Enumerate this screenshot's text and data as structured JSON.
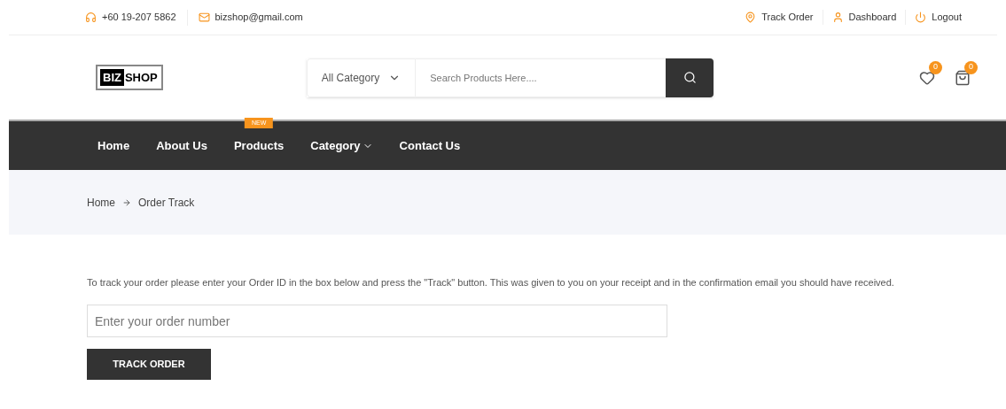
{
  "topbar": {
    "phone": "+60 19-207 5862",
    "email": "bizshop@gmail.com",
    "links": [
      {
        "kind": "pin",
        "label": "Track Order"
      },
      {
        "kind": "user",
        "label": "Dashboard"
      },
      {
        "kind": "power",
        "label": "Logout"
      }
    ]
  },
  "header": {
    "logo": {
      "dark_part": "BIZ",
      "light_part": "SHOP"
    },
    "category_select": "All Category",
    "search": {
      "placeholder": "Search Products Here...."
    },
    "wishlist_count": "0",
    "cart_count": "0"
  },
  "nav": [
    {
      "label": "Home",
      "dropdown": false
    },
    {
      "label": "About Us",
      "dropdown": false
    },
    {
      "label": "Products",
      "badge": "NEW",
      "dropdown": false
    },
    {
      "label": "Category",
      "dropdown": true
    },
    {
      "label": "Contact Us",
      "dropdown": false
    }
  ],
  "breadcrumb": [
    "Home",
    "Order Track"
  ],
  "intro": "To track your order please enter your Order ID in the box below and press the \"Track\" button. This was given to you on your receipt and in the confirmation email you should have received.",
  "order_field": {
    "placeholder": "Enter your order number"
  },
  "track_button": "TRACK ORDER"
}
